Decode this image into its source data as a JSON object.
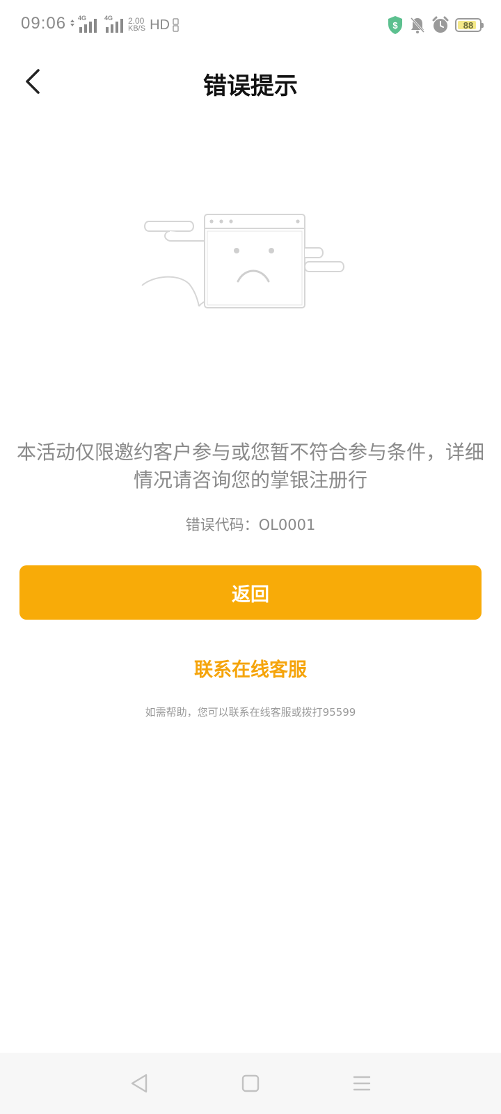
{
  "status_bar": {
    "time": "09:06",
    "network_1": "4G",
    "network_2": "4G",
    "speed_value": "2.00",
    "speed_unit": "KB/S",
    "hd_label": "HD",
    "battery_level": "88",
    "battery_fraction": 0.88,
    "icons": [
      "signal-icon",
      "security-shield-icon",
      "mute-bell-icon",
      "alarm-clock-icon",
      "battery-icon"
    ]
  },
  "header": {
    "title": "错误提示",
    "back_icon": "chevron-left-icon"
  },
  "illustration": {
    "icon": "sad-browser-window-icon"
  },
  "content": {
    "message": "本活动仅限邀约客户参与或您暂不符合参与条件，详细情况请咨询您的掌银注册行",
    "error_code": "错误代码：OL0001",
    "return_label": "返回",
    "contact_label": "联系在线客服",
    "help_text": "如需帮助，您可以联系在线客服或拨打95599"
  },
  "colors": {
    "primary": "#f8ab08",
    "link": "#f5a40b",
    "text_secondary": "#8a8a8a",
    "title": "#111111"
  },
  "nav_bar": {
    "icons": [
      "nav-back-icon",
      "nav-home-icon",
      "nav-menu-icon"
    ]
  }
}
